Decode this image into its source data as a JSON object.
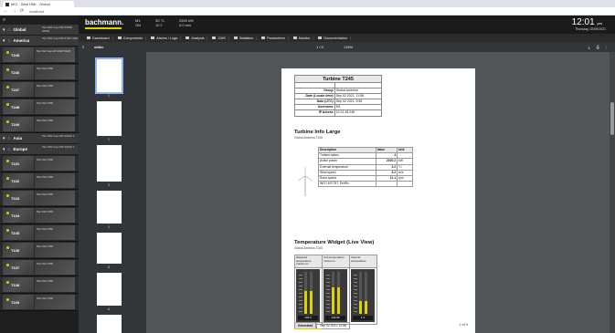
{
  "browser": {
    "tab_title": "MCI - Web HMI - Global",
    "url": "localhost"
  },
  "sidebar": {
    "groups": [
      {
        "name": "Global",
        "stats": [
          "Pwr MW",
          "Cap MW",
          "50958",
          "34056"
        ]
      },
      {
        "name": "America",
        "stats": [
          "Pwr MW",
          "Cap MW",
          "5795",
          "1038"
        ]
      },
      {
        "name": "Asia",
        "stats": [
          "Pwr MW",
          "Cap MW",
          "20910",
          "1"
        ]
      },
      {
        "name": "Europe",
        "stats": [
          "Pwr MW",
          "Cap MW",
          "30916",
          "1"
        ]
      }
    ],
    "items": [
      {
        "label": "T245",
        "vals": "Pwr kW Cap kW 2020 5128"
      },
      {
        "label": "T246",
        "vals": "Pwr kW 1768"
      },
      {
        "label": "T247",
        "vals": "Pwr kW 1768"
      },
      {
        "label": "T248",
        "vals": "Pwr kW 1768"
      },
      {
        "label": "T249",
        "vals": "Pwr kW 1768"
      },
      {
        "label": "T101",
        "vals": "Pwr kW 1768"
      },
      {
        "label": "T102",
        "vals": "Pwr kW 1768"
      },
      {
        "label": "T103",
        "vals": "Pwr kW 1768"
      },
      {
        "label": "T104",
        "vals": "Pwr kW 1768"
      },
      {
        "label": "T105",
        "vals": "Pwr kW 1768"
      },
      {
        "label": "T106",
        "vals": "Pwr kW 1768"
      },
      {
        "label": "T107",
        "vals": "Pwr kW 1768"
      },
      {
        "label": "T108",
        "vals": "Pwr kW 1768"
      },
      {
        "label": "T109",
        "vals": "Pwr kW 1768"
      }
    ]
  },
  "header": {
    "logo": "bachmann.",
    "stats": [
      [
        "M1",
        "ON"
      ],
      [
        "30 °C",
        "10 ◊"
      ],
      [
        "2500 kW",
        "0.0 m/s"
      ]
    ],
    "clock": "12:01",
    "ampm": "pm",
    "date": "Thursday, 02/09/2021"
  },
  "menu": [
    "Dashboard",
    "Components",
    "Alarms / Logs",
    "Analysis",
    "CMS",
    "Statistics",
    "Parameters",
    "Monitor",
    "Documentation"
  ],
  "pdf": {
    "name": "sfdkc",
    "pages": "1 / 9",
    "zoom": "134%"
  },
  "document": {
    "title": "Turbine T245",
    "info": [
      [
        "Group",
        "Global.America"
      ],
      [
        "Date (Locale time)",
        "Sep 02 2021, 11:58"
      ],
      [
        "Date (UTC)",
        "Sep 02 2021, 9:58"
      ],
      [
        "Username",
        "M1"
      ],
      [
        "IP Adress",
        "10.31.45.245"
      ]
    ],
    "info_large_title": "Turbine Info Large",
    "info_large_sub": "Global.America.T245",
    "signals_header": [
      "Description",
      "Value",
      "Unit"
    ],
    "signals": [
      [
        "Turbine status",
        "4",
        ""
      ],
      [
        "Active power",
        "2020.2",
        "kW"
      ],
      [
        "External temperature",
        "3.2",
        "°C"
      ],
      [
        "Wind speed",
        "9.2",
        "m/s"
      ],
      [
        "Rotor speed",
        "11.1",
        "rpm"
      ],
      [
        "INFO MTCRT. PerRfx",
        "",
        ""
      ]
    ],
    "temp_title": "Temperature Widget (Live View)",
    "temp_sub": "Global.America.T245",
    "temp_cols": [
      "Weighed temperature maximum",
      "Coil temperature minimum",
      "Internal temperature"
    ],
    "temp_vals": [
      "145.0",
      "132.56",
      "1.3"
    ],
    "temp_levels": [
      0.55,
      0.62,
      0.3
    ],
    "generated_label": "Generated",
    "generated_date": "Sep 02 2021, 11:58",
    "page_of": "2 of 9"
  },
  "thumb_numbers": [
    "1",
    "2",
    "3",
    "4",
    "5",
    "6",
    "7"
  ]
}
